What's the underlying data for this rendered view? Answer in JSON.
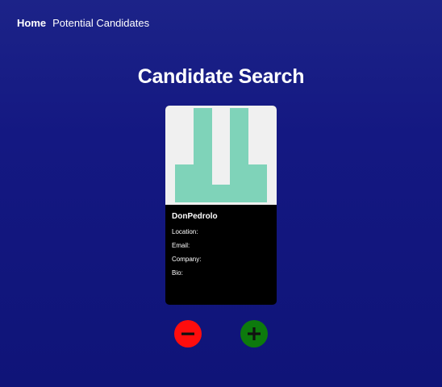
{
  "nav": {
    "home_label": "Home",
    "potential_label": "Potential Candidates"
  },
  "page": {
    "title": "Candidate Search"
  },
  "candidate": {
    "username": "DonPedrolo",
    "location_label": "Location:",
    "email_label": "Email:",
    "company_label": "Company:",
    "bio_label": "Bio:",
    "avatar_icon": "identicon-avatar"
  },
  "actions": {
    "reject_icon": "minus-icon",
    "accept_icon": "plus-icon"
  },
  "colors": {
    "background": "#141882",
    "card": "#000000",
    "avatar_bg": "#f0f0f0",
    "identicon": "#7fd3b9",
    "reject": "#ff0d0d",
    "accept": "#0d7a0d"
  }
}
